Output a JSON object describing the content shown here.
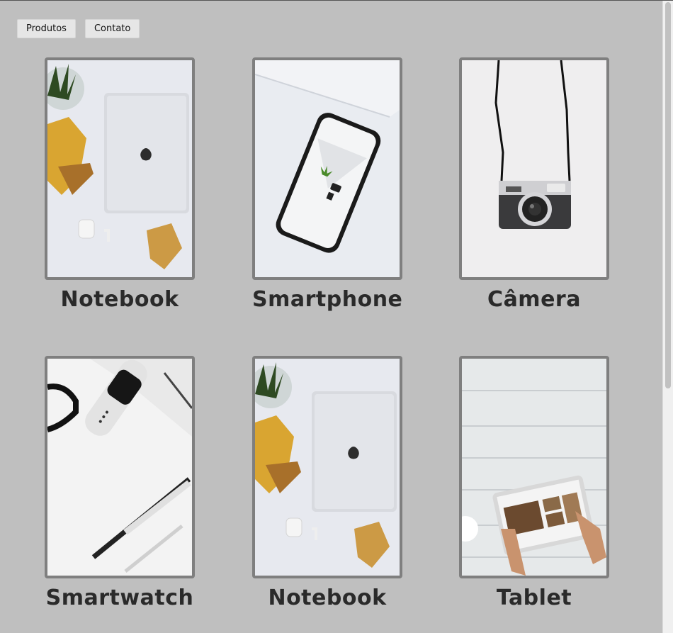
{
  "nav": {
    "items": [
      {
        "label": "Produtos"
      },
      {
        "label": "Contato"
      }
    ]
  },
  "products": [
    {
      "name": "Notebook",
      "image": "notebook-image"
    },
    {
      "name": "Smartphone",
      "image": "smartphone-image"
    },
    {
      "name": "Câmera",
      "image": "camera-image"
    },
    {
      "name": "Smartwatch",
      "image": "smartwatch-image"
    },
    {
      "name": "Notebook",
      "image": "notebook-image"
    },
    {
      "name": "Tablet",
      "image": "tablet-image"
    }
  ],
  "colors": {
    "background": "#bfbfbf",
    "frame_border": "#7f7f7f",
    "label_text": "#2a2a2a"
  }
}
